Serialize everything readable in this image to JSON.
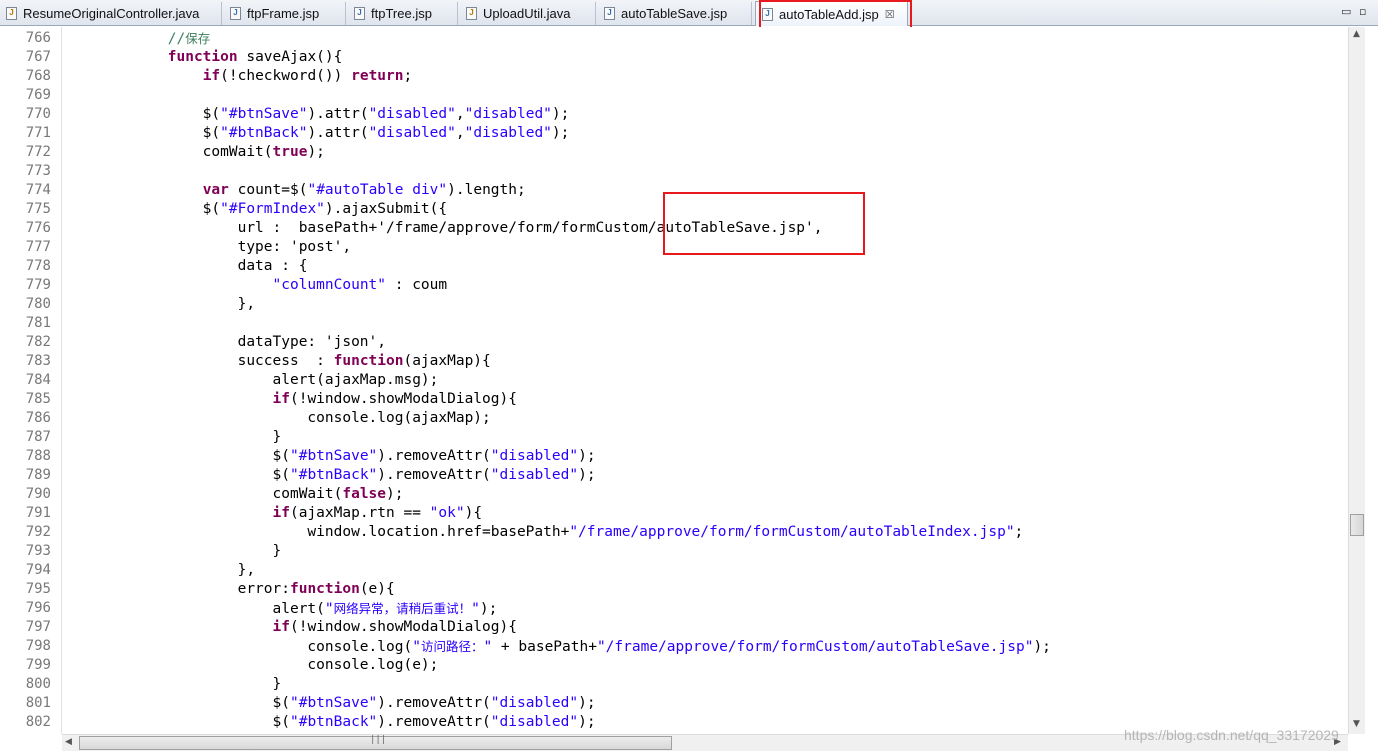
{
  "tabs": [
    {
      "label": "ResumeOriginalController.java",
      "icon": "java-file-icon"
    },
    {
      "label": "ftpFrame.jsp",
      "icon": "jsp-file-icon"
    },
    {
      "label": "ftpTree.jsp",
      "icon": "jsp-file-icon"
    },
    {
      "label": "UploadUtil.java",
      "icon": "java-file-icon"
    },
    {
      "label": "autoTableSave.jsp",
      "icon": "jsp-file-icon"
    },
    {
      "label": "autoTableAdd.jsp",
      "icon": "jsp-file-icon",
      "active": true
    }
  ],
  "window_controls": {
    "minimize": "▭",
    "restore": "▫"
  },
  "code_lines": [
    {
      "n": "766",
      "segs": [
        [
          "cm",
          "            //"
        ],
        [
          "cmcjk",
          "保存"
        ]
      ]
    },
    {
      "n": "767",
      "segs": [
        [
          "",
          "            "
        ],
        [
          "kw",
          "function"
        ],
        [
          "",
          " saveAjax(){"
        ]
      ]
    },
    {
      "n": "768",
      "segs": [
        [
          "",
          "                "
        ],
        [
          "kw",
          "if"
        ],
        [
          "",
          "(!checkword()) "
        ],
        [
          "kw",
          "return"
        ],
        [
          "",
          ";"
        ]
      ]
    },
    {
      "n": "769",
      "segs": [
        [
          "",
          ""
        ]
      ]
    },
    {
      "n": "770",
      "segs": [
        [
          "",
          "                $("
        ],
        [
          "str",
          "\"#btnSave\""
        ],
        [
          "",
          ").attr("
        ],
        [
          "str",
          "\"disabled\""
        ],
        [
          "",
          ","
        ],
        [
          "str",
          "\"disabled\""
        ],
        [
          "",
          ");"
        ]
      ]
    },
    {
      "n": "771",
      "segs": [
        [
          "",
          "                $("
        ],
        [
          "str",
          "\"#btnBack\""
        ],
        [
          "",
          ").attr("
        ],
        [
          "str",
          "\"disabled\""
        ],
        [
          "",
          ","
        ],
        [
          "str",
          "\"disabled\""
        ],
        [
          "",
          ");"
        ]
      ]
    },
    {
      "n": "772",
      "segs": [
        [
          "",
          "                comWait("
        ],
        [
          "kw",
          "true"
        ],
        [
          "",
          ");"
        ]
      ]
    },
    {
      "n": "773",
      "segs": [
        [
          "",
          ""
        ]
      ]
    },
    {
      "n": "774",
      "segs": [
        [
          "",
          "                "
        ],
        [
          "kw",
          "var"
        ],
        [
          "",
          " count=$("
        ],
        [
          "str",
          "\"#autoTable div\""
        ],
        [
          "",
          ").length;"
        ]
      ]
    },
    {
      "n": "775",
      "segs": [
        [
          "",
          "                $("
        ],
        [
          "str",
          "\"#FormIndex\""
        ],
        [
          "",
          ").ajaxSubmit({"
        ]
      ]
    },
    {
      "n": "776",
      "segs": [
        [
          "",
          "                    url :  basePath+'/frame/approve/form/formCustom/autoTableSave.jsp',"
        ]
      ]
    },
    {
      "n": "777",
      "segs": [
        [
          "",
          "                    type: 'post',"
        ]
      ]
    },
    {
      "n": "778",
      "segs": [
        [
          "",
          "                    data : {"
        ]
      ]
    },
    {
      "n": "779",
      "segs": [
        [
          "",
          "                        "
        ],
        [
          "str",
          "\"columnCount\""
        ],
        [
          "",
          " : coum"
        ]
      ]
    },
    {
      "n": "780",
      "segs": [
        [
          "",
          "                    },"
        ]
      ]
    },
    {
      "n": "781",
      "segs": [
        [
          "",
          ""
        ]
      ]
    },
    {
      "n": "782",
      "segs": [
        [
          "",
          "                    dataType: 'json',"
        ]
      ]
    },
    {
      "n": "783",
      "segs": [
        [
          "",
          "                    success  : "
        ],
        [
          "kw",
          "function"
        ],
        [
          "",
          "(ajaxMap){"
        ]
      ]
    },
    {
      "n": "784",
      "segs": [
        [
          "",
          "                        alert(ajaxMap.msg);"
        ]
      ]
    },
    {
      "n": "785",
      "segs": [
        [
          "",
          "                        "
        ],
        [
          "kw",
          "if"
        ],
        [
          "",
          "(!window.showModalDialog){"
        ]
      ]
    },
    {
      "n": "786",
      "segs": [
        [
          "",
          "                            console.log(ajaxMap);"
        ]
      ]
    },
    {
      "n": "787",
      "segs": [
        [
          "",
          "                        }"
        ]
      ]
    },
    {
      "n": "788",
      "segs": [
        [
          "",
          "                        $("
        ],
        [
          "str",
          "\"#btnSave\""
        ],
        [
          "",
          ").removeAttr("
        ],
        [
          "str",
          "\"disabled\""
        ],
        [
          "",
          ");"
        ]
      ]
    },
    {
      "n": "789",
      "segs": [
        [
          "",
          "                        $("
        ],
        [
          "str",
          "\"#btnBack\""
        ],
        [
          "",
          ").removeAttr("
        ],
        [
          "str",
          "\"disabled\""
        ],
        [
          "",
          ");"
        ]
      ]
    },
    {
      "n": "790",
      "segs": [
        [
          "",
          "                        comWait("
        ],
        [
          "kw",
          "false"
        ],
        [
          "",
          ");"
        ]
      ]
    },
    {
      "n": "791",
      "segs": [
        [
          "",
          "                        "
        ],
        [
          "kw",
          "if"
        ],
        [
          "",
          "(ajaxMap.rtn == "
        ],
        [
          "str",
          "\"ok\""
        ],
        [
          "",
          "){"
        ]
      ]
    },
    {
      "n": "792",
      "segs": [
        [
          "",
          "                            window.location.href=basePath+"
        ],
        [
          "str",
          "\"/frame/approve/form/formCustom/autoTableIndex.jsp\""
        ],
        [
          "",
          ";"
        ]
      ]
    },
    {
      "n": "793",
      "segs": [
        [
          "",
          "                        }"
        ]
      ]
    },
    {
      "n": "794",
      "segs": [
        [
          "",
          "                    },"
        ]
      ]
    },
    {
      "n": "795",
      "segs": [
        [
          "",
          "                    error:"
        ],
        [
          "kw",
          "function"
        ],
        [
          "",
          "(e){"
        ]
      ]
    },
    {
      "n": "796",
      "segs": [
        [
          "",
          "                        alert("
        ],
        [
          "str",
          "\""
        ],
        [
          "strcjk",
          "网络异常，请稍后重试！"
        ],
        [
          "str",
          "\""
        ],
        [
          "",
          ");"
        ]
      ]
    },
    {
      "n": "797",
      "segs": [
        [
          "",
          "                        "
        ],
        [
          "kw",
          "if"
        ],
        [
          "",
          "(!window.showModalDialog){"
        ]
      ]
    },
    {
      "n": "798",
      "segs": [
        [
          "",
          "                            console.log("
        ],
        [
          "str",
          "\""
        ],
        [
          "strcjk",
          "访问路径："
        ],
        [
          "str",
          "\""
        ],
        [
          "",
          " + basePath+"
        ],
        [
          "str",
          "\"/frame/approve/form/formCustom/autoTableSave.jsp\""
        ],
        [
          "",
          ");"
        ]
      ]
    },
    {
      "n": "799",
      "segs": [
        [
          "",
          "                            console.log(e);"
        ]
      ]
    },
    {
      "n": "800",
      "segs": [
        [
          "",
          "                        }"
        ]
      ]
    },
    {
      "n": "801",
      "segs": [
        [
          "",
          "                        $("
        ],
        [
          "str",
          "\"#btnSave\""
        ],
        [
          "",
          ").removeAttr("
        ],
        [
          "str",
          "\"disabled\""
        ],
        [
          "",
          ");"
        ]
      ]
    },
    {
      "n": "802",
      "segs": [
        [
          "",
          "                        $("
        ],
        [
          "str",
          "\"#btnBack\""
        ],
        [
          "",
          ").removeAttr("
        ],
        [
          "str",
          "\"disabled\""
        ],
        [
          "",
          ");"
        ]
      ]
    }
  ],
  "watermark": "https://blog.csdn.net/qq_33172029",
  "colors": {
    "keyword": "#7f0055",
    "string": "#2a00ff",
    "comment": "#3f7f5f",
    "highlight_box": "#e8191c"
  }
}
